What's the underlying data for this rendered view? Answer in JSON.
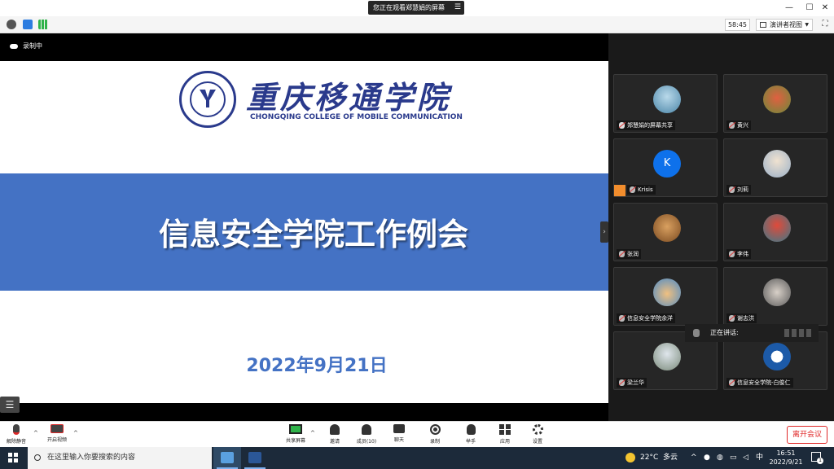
{
  "title_bar": {
    "share_notice": "您正在观看郑慧娟的屏幕",
    "share_menu_icon": "menu-icon"
  },
  "info_bar": {
    "timer": "58:45",
    "view_label": "演讲者视图"
  },
  "stage": {
    "recording_label": "录制中",
    "slide": {
      "college_name_cn": "重庆移通学院",
      "college_name_en": "CHONGQING COLLEGE OF MOBILE COMMUNICATION",
      "title": "信息安全学院工作例会",
      "date": "2022年9月21日"
    }
  },
  "participants": [
    {
      "name": "郑慧娟的屏幕共享",
      "avatar": "photo",
      "muted": false
    },
    {
      "name": "黄兴",
      "avatar": "photo",
      "muted": true
    },
    {
      "name": "Krisis",
      "avatar": "K",
      "avatar_color": "#0e71eb",
      "muted": true,
      "host": true
    },
    {
      "name": "刘莉",
      "avatar": "photo",
      "muted": true
    },
    {
      "name": "张润",
      "avatar": "photo",
      "muted": true
    },
    {
      "name": "李伟",
      "avatar": "photo",
      "muted": true
    },
    {
      "name": "信息安全学院余洋",
      "avatar": "photo",
      "muted": true
    },
    {
      "name": "谢志洪",
      "avatar": "photo",
      "muted": true
    },
    {
      "name": "梁兰华",
      "avatar": "photo",
      "muted": true
    },
    {
      "name": "信息安全学院-白俊仁",
      "avatar": "photo",
      "muted": true
    }
  ],
  "speaking_label": "正在讲话:",
  "toolbar": {
    "unmute": "解除静音",
    "start_video": "开启视频",
    "share_screen": "共享屏幕",
    "invite": "邀请",
    "members": "成员(10)",
    "chat": "聊天",
    "record": "录制",
    "raise_hand": "举手",
    "apps": "应用",
    "settings": "设置",
    "leave": "离开会议"
  },
  "taskbar": {
    "search_placeholder": "在这里输入你要搜索的内容",
    "temperature": "22°C",
    "weather": "多云",
    "ime": "中",
    "time": "16:51",
    "date": "2022/9/21",
    "notification_count": "1"
  },
  "colors": {
    "accent": "#0e71eb",
    "slide_band": "#4472c4",
    "college_blue": "#2a3a8c",
    "leave_red": "#e02828"
  }
}
